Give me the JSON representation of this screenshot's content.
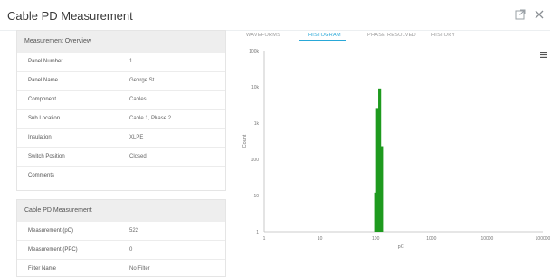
{
  "header": {
    "title": "Cable PD Measurement",
    "expand_icon": "external-link-icon",
    "close_icon": "close-icon"
  },
  "overview": {
    "title": "Measurement Overview",
    "rows": [
      {
        "label": "Panel Number",
        "value": "1"
      },
      {
        "label": "Panel Name",
        "value": "George St"
      },
      {
        "label": "Component",
        "value": "Cables"
      },
      {
        "label": "Sub Location",
        "value": "Cable 1, Phase 2"
      },
      {
        "label": "Insulation",
        "value": "XLPE"
      },
      {
        "label": "Switch Position",
        "value": "Closed"
      },
      {
        "label": "Comments",
        "value": ""
      }
    ]
  },
  "measurement": {
    "title": "Cable PD Measurement",
    "rows": [
      {
        "label": "Measurement (pC)",
        "value": "522"
      },
      {
        "label": "Measurement (PPC)",
        "value": "0"
      },
      {
        "label": "Filter Name",
        "value": "No Filter"
      }
    ]
  },
  "tabs": [
    "WAVEFORMS",
    "HISTOGRAM",
    "PHASE RESOLVED",
    "HISTORY"
  ],
  "active_tab": "HISTOGRAM",
  "colors": {
    "accent": "#29a8d8",
    "bar": "#1e9a1e"
  },
  "chart_data": {
    "type": "bar",
    "xlabel": "pC",
    "ylabel": "Count",
    "x_scale": "log",
    "y_scale": "log",
    "xlim": [
      1,
      100000
    ],
    "ylim": [
      1,
      100000
    ],
    "x_ticks": [
      "1",
      "10",
      "100",
      "1000",
      "10000",
      "100000"
    ],
    "y_ticks": [
      "1",
      "10",
      "100",
      "1k",
      "10k",
      "100k"
    ],
    "bars": [
      {
        "x": 100,
        "y": 12
      },
      {
        "x": 108,
        "y": 2600
      },
      {
        "x": 118,
        "y": 9000
      },
      {
        "x": 128,
        "y": 230
      }
    ]
  }
}
